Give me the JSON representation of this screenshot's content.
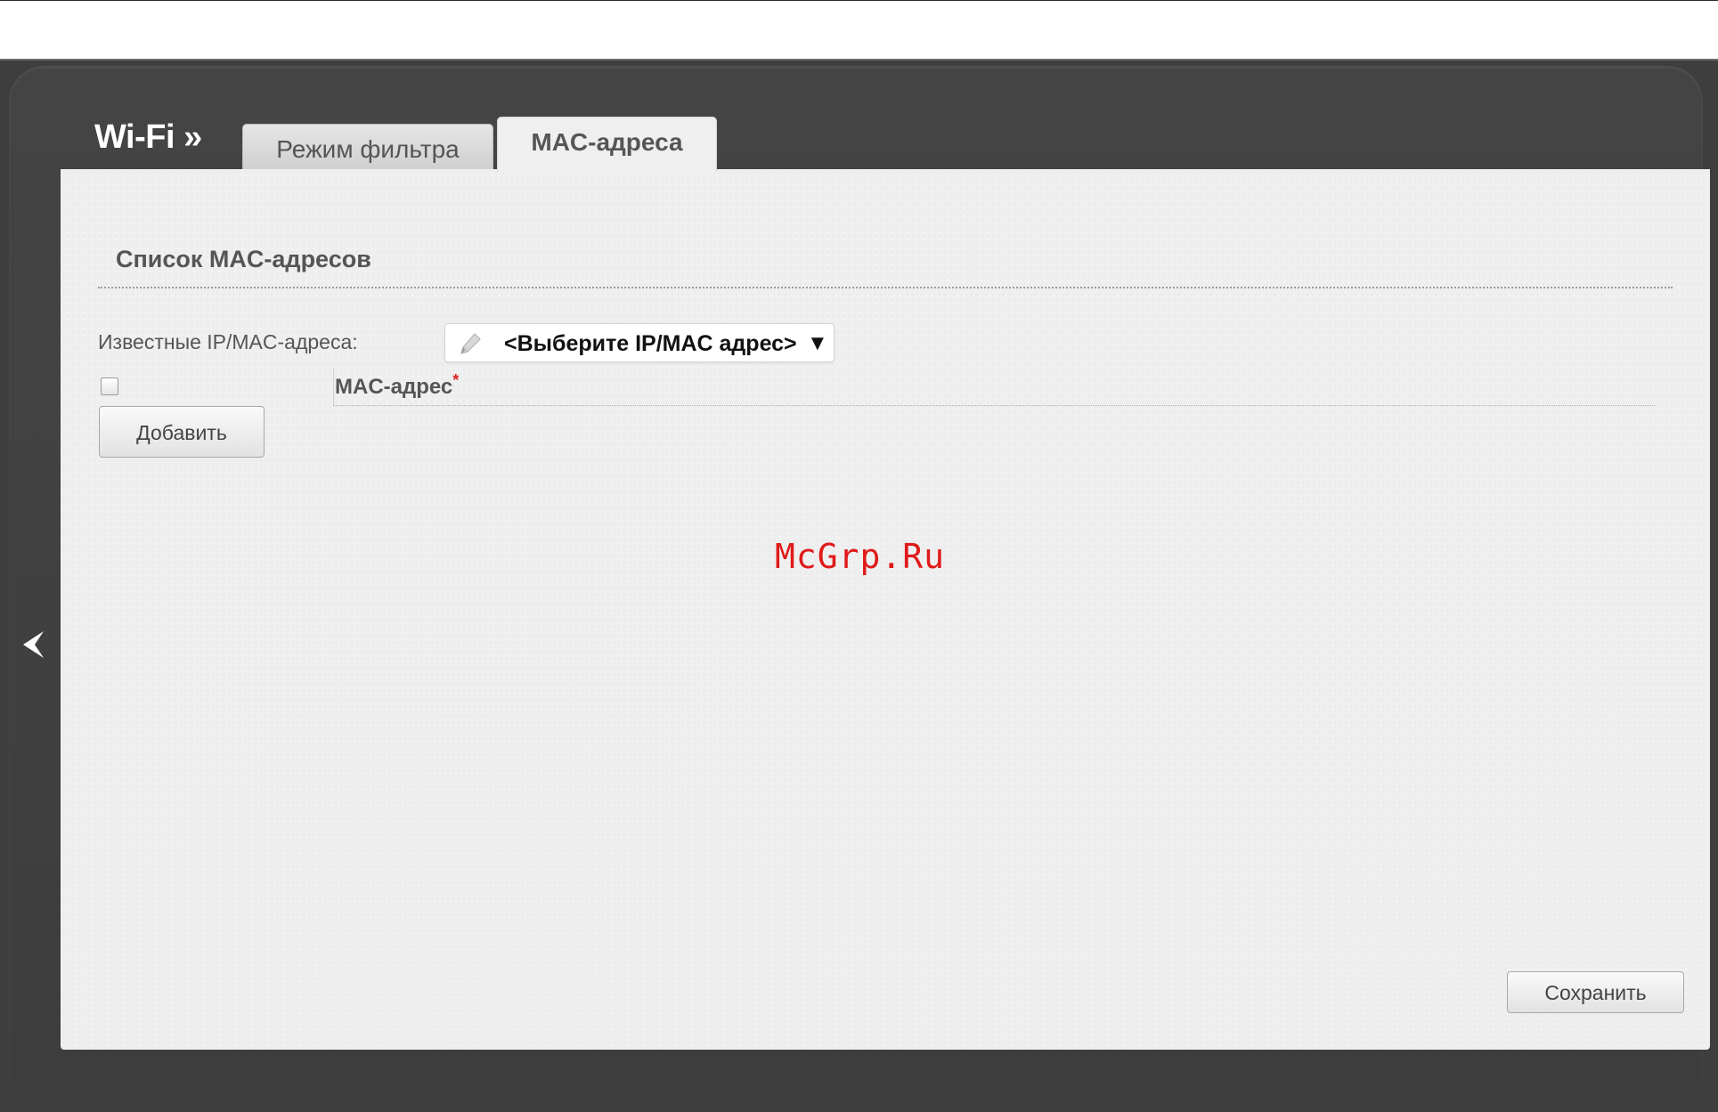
{
  "header": {
    "section_title": "Wi-Fi »"
  },
  "tabs": [
    {
      "label": "Режим фильтра",
      "active": false
    },
    {
      "label": "MAC-адреса",
      "active": true
    }
  ],
  "mac_list": {
    "heading": "Список MAC-адресов",
    "known_label": "Известные IP/MAC-адреса:",
    "select": {
      "selected_value": "<Выберите IP/MAC адрес>",
      "arrow": "▼",
      "icon": "pencil-icon"
    },
    "table": {
      "select_all_checked": false,
      "column_label": "MAC-адрес",
      "required_mark": "*"
    },
    "add_button": "Добавить"
  },
  "save_button": "Сохранить",
  "watermark": "McGrp.Ru",
  "nav": {
    "back_icon": "chevron-left-icon"
  },
  "colors": {
    "frame": "#3e3e3e",
    "content_bg": "#efefef",
    "required": "#dd2222",
    "watermark": "#e01a1a"
  }
}
